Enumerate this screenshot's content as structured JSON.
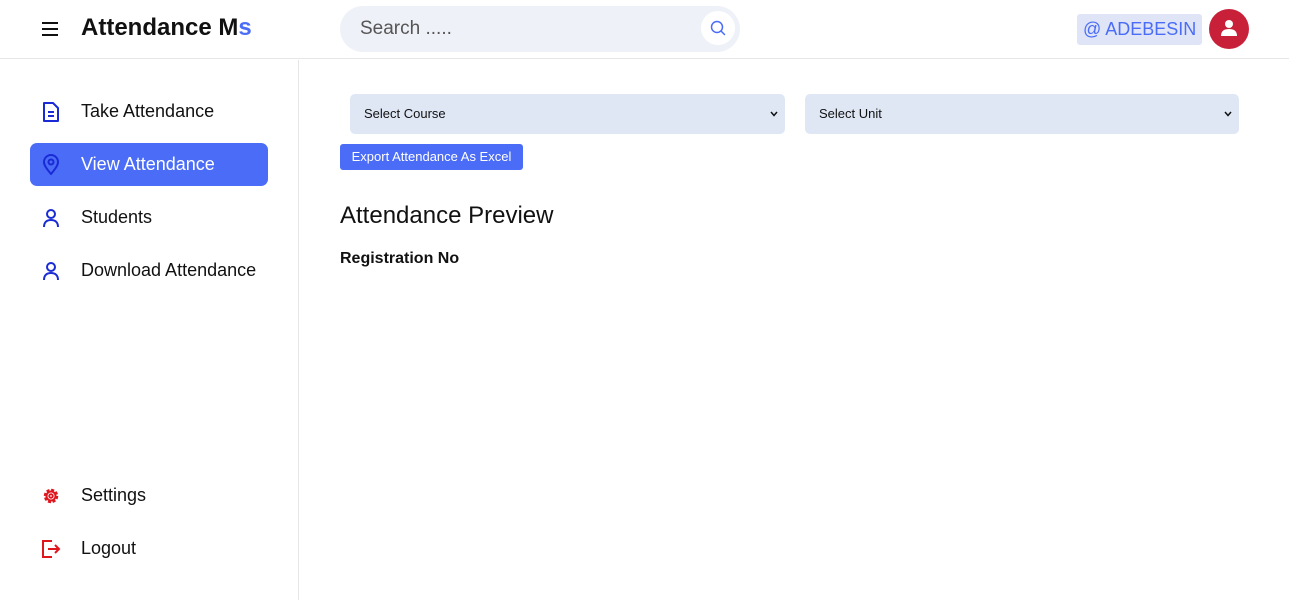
{
  "header": {
    "brand_main": "Attendance M",
    "brand_accent": "s",
    "search": {
      "placeholder": "Search ....."
    },
    "user_tag": "@ ADEBESIN"
  },
  "sidebar": {
    "items": [
      {
        "label": "Take Attendance",
        "icon": "document-icon",
        "active": false
      },
      {
        "label": "View Attendance",
        "icon": "map-pin-icon",
        "active": true
      },
      {
        "label": "Students",
        "icon": "user-icon",
        "active": false
      },
      {
        "label": "Download Attendance",
        "icon": "user-icon",
        "active": false
      }
    ],
    "bottom_items": [
      {
        "label": "Settings",
        "icon": "gear-icon"
      },
      {
        "label": "Logout",
        "icon": "logout-icon"
      }
    ]
  },
  "main": {
    "course_select": {
      "selected": "Select Course"
    },
    "unit_select": {
      "selected": "Select Unit"
    },
    "export_label": "Export Attendance As Excel",
    "preview_title": "Attendance Preview",
    "table_header": "Registration No"
  },
  "colors": {
    "accent": "#4a6cf7",
    "nav_icon_blue": "#1a2bd6",
    "nav_icon_red": "#e0161e",
    "avatar_bg": "#c9203a",
    "select_bg": "#dfe7f5"
  }
}
